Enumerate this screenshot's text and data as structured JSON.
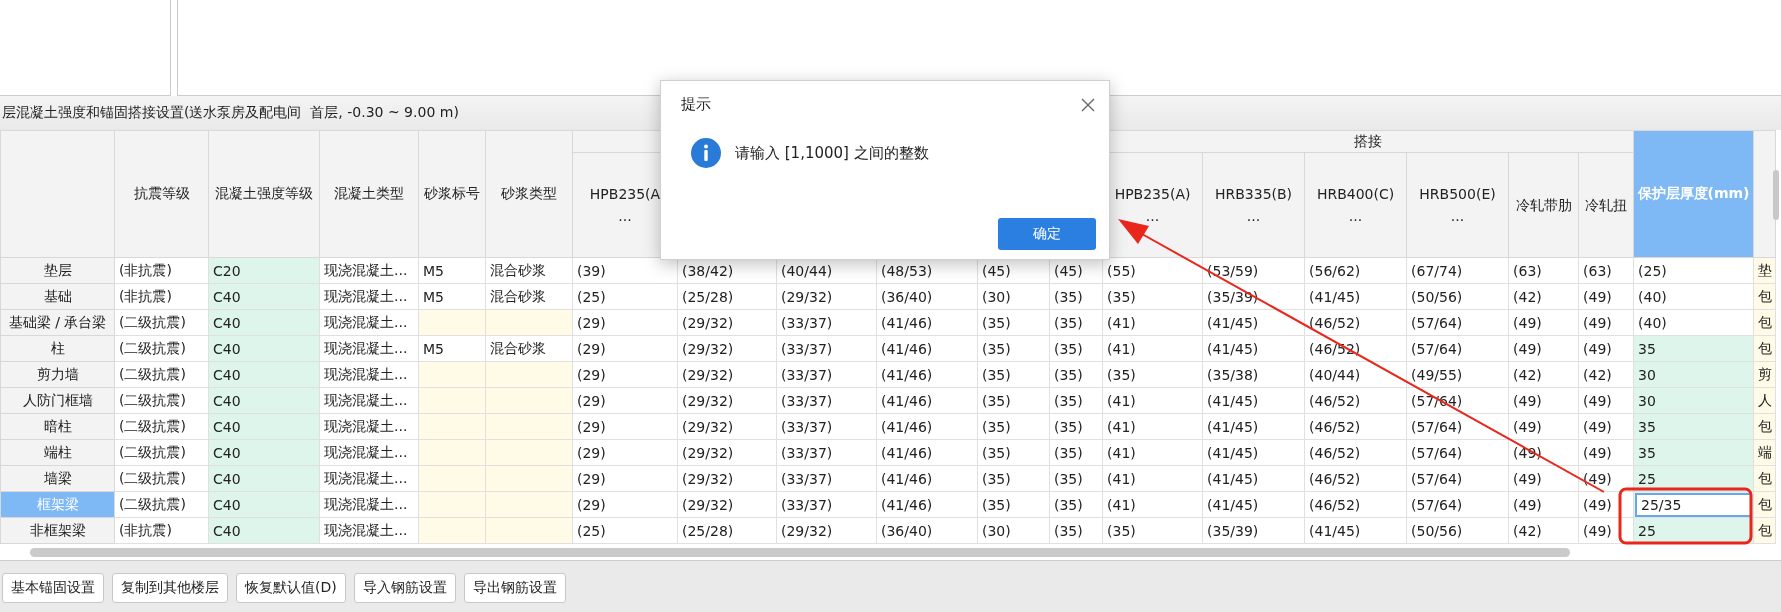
{
  "settings_title": "层混凝土强度和锚固搭接设置(送水泵房及配电间  首层, -0.30 ~ 9.00 m)",
  "table": {
    "left_columns": [
      "抗震等级",
      "混凝土强度等级",
      "混凝土类型",
      "砂浆标号",
      "砂浆类型"
    ],
    "anchorage_columns": [
      "HPB235(A\n..."
    ],
    "lap_group": "搭接",
    "lap_columns": [
      "HPB235(A)\n...",
      "HRB335(B)\n...",
      "HRB400(C)\n...",
      "HRB500(E)\n...",
      "冷轧带肋",
      "冷轧扭"
    ],
    "cover_column": "保护层厚度(mm)",
    "rows": [
      {
        "label": "垫层",
        "selected": false,
        "cells": [
          "(非抗震)",
          "C20",
          "现浇混凝土...",
          "M5",
          "混合砂浆",
          "(39)",
          "(38/42)",
          "(40/44)",
          "(48/53)",
          "(45)",
          "(45)",
          "(55)",
          "(53/59)",
          "(56/62)",
          "(67/74)",
          "(63)",
          "(63)"
        ],
        "cover": "(25)",
        "cover_custom": false,
        "cover_editing": false,
        "tail": "垫"
      },
      {
        "label": "基础",
        "selected": false,
        "cells": [
          "(非抗震)",
          "C40",
          "现浇混凝土...",
          "M5",
          "混合砂浆",
          "(25)",
          "(25/28)",
          "(29/32)",
          "(36/40)",
          "(30)",
          "(35)",
          "(35)",
          "(35/39)",
          "(41/45)",
          "(50/56)",
          "(42)",
          "(49)"
        ],
        "cover": "(40)",
        "cover_custom": false,
        "cover_editing": false,
        "tail": "包"
      },
      {
        "label": "基础梁 / 承台梁",
        "selected": false,
        "cells": [
          "(二级抗震)",
          "C40",
          "现浇混凝土...",
          null,
          null,
          "(29)",
          "(29/32)",
          "(33/37)",
          "(41/46)",
          "(35)",
          "(35)",
          "(41)",
          "(41/45)",
          "(46/52)",
          "(57/64)",
          "(49)",
          "(49)"
        ],
        "cover": "(40)",
        "cover_custom": false,
        "cover_editing": false,
        "tail": "包"
      },
      {
        "label": "柱",
        "selected": false,
        "cells": [
          "(二级抗震)",
          "C40",
          "现浇混凝土...",
          "M5",
          "混合砂浆",
          "(29)",
          "(29/32)",
          "(33/37)",
          "(41/46)",
          "(35)",
          "(35)",
          "(41)",
          "(41/45)",
          "(46/52)",
          "(57/64)",
          "(49)",
          "(49)"
        ],
        "cover": "35",
        "cover_custom": true,
        "cover_editing": false,
        "tail": "包"
      },
      {
        "label": "剪力墙",
        "selected": false,
        "cells": [
          "(二级抗震)",
          "C40",
          "现浇混凝土...",
          null,
          null,
          "(29)",
          "(29/32)",
          "(33/37)",
          "(41/46)",
          "(35)",
          "(35)",
          "(35)",
          "(35/38)",
          "(40/44)",
          "(49/55)",
          "(42)",
          "(42)"
        ],
        "cover": "30",
        "cover_custom": true,
        "cover_editing": false,
        "tail": "剪"
      },
      {
        "label": "人防门框墙",
        "selected": false,
        "cells": [
          "(二级抗震)",
          "C40",
          "现浇混凝土...",
          null,
          null,
          "(29)",
          "(29/32)",
          "(33/37)",
          "(41/46)",
          "(35)",
          "(35)",
          "(41)",
          "(41/45)",
          "(46/52)",
          "(57/64)",
          "(49)",
          "(49)"
        ],
        "cover": "30",
        "cover_custom": true,
        "cover_editing": false,
        "tail": "人"
      },
      {
        "label": "暗柱",
        "selected": false,
        "cells": [
          "(二级抗震)",
          "C40",
          "现浇混凝土...",
          null,
          null,
          "(29)",
          "(29/32)",
          "(33/37)",
          "(41/46)",
          "(35)",
          "(35)",
          "(41)",
          "(41/45)",
          "(46/52)",
          "(57/64)",
          "(49)",
          "(49)"
        ],
        "cover": "35",
        "cover_custom": true,
        "cover_editing": false,
        "tail": "包"
      },
      {
        "label": "端柱",
        "selected": false,
        "cells": [
          "(二级抗震)",
          "C40",
          "现浇混凝土...",
          null,
          null,
          "(29)",
          "(29/32)",
          "(33/37)",
          "(41/46)",
          "(35)",
          "(35)",
          "(41)",
          "(41/45)",
          "(46/52)",
          "(57/64)",
          "(49)",
          "(49)"
        ],
        "cover": "35",
        "cover_custom": true,
        "cover_editing": false,
        "tail": "端"
      },
      {
        "label": "墙梁",
        "selected": false,
        "cells": [
          "(二级抗震)",
          "C40",
          "现浇混凝土...",
          null,
          null,
          "(29)",
          "(29/32)",
          "(33/37)",
          "(41/46)",
          "(35)",
          "(35)",
          "(41)",
          "(41/45)",
          "(46/52)",
          "(57/64)",
          "(49)",
          "(49)"
        ],
        "cover": "25",
        "cover_custom": true,
        "cover_editing": false,
        "tail": "包"
      },
      {
        "label": "框架梁",
        "selected": true,
        "cells": [
          "(二级抗震)",
          "C40",
          "现浇混凝土...",
          null,
          null,
          "(29)",
          "(29/32)",
          "(33/37)",
          "(41/46)",
          "(35)",
          "(35)",
          "(41)",
          "(41/45)",
          "(46/52)",
          "(57/64)",
          "(49)",
          "(49)"
        ],
        "cover": "25/35",
        "cover_custom": true,
        "cover_editing": true,
        "tail": "包"
      },
      {
        "label": "非框架梁",
        "selected": false,
        "cells": [
          "(非抗震)",
          "C40",
          "现浇混凝土...",
          null,
          null,
          "(25)",
          "(25/28)",
          "(29/32)",
          "(36/40)",
          "(30)",
          "(35)",
          "(35)",
          "(35/39)",
          "(41/45)",
          "(50/56)",
          "(42)",
          "(49)"
        ],
        "cover": "25",
        "cover_custom": true,
        "cover_editing": false,
        "tail": "包"
      }
    ]
  },
  "buttons": [
    "基本锚固设置",
    "复制到其他楼层",
    "恢复默认值(D)",
    "导入钢筋设置",
    "导出钢筋设置"
  ],
  "dialog": {
    "title": "提示",
    "message": "请输入 [1,1000] 之间的整数",
    "button": "确定"
  }
}
